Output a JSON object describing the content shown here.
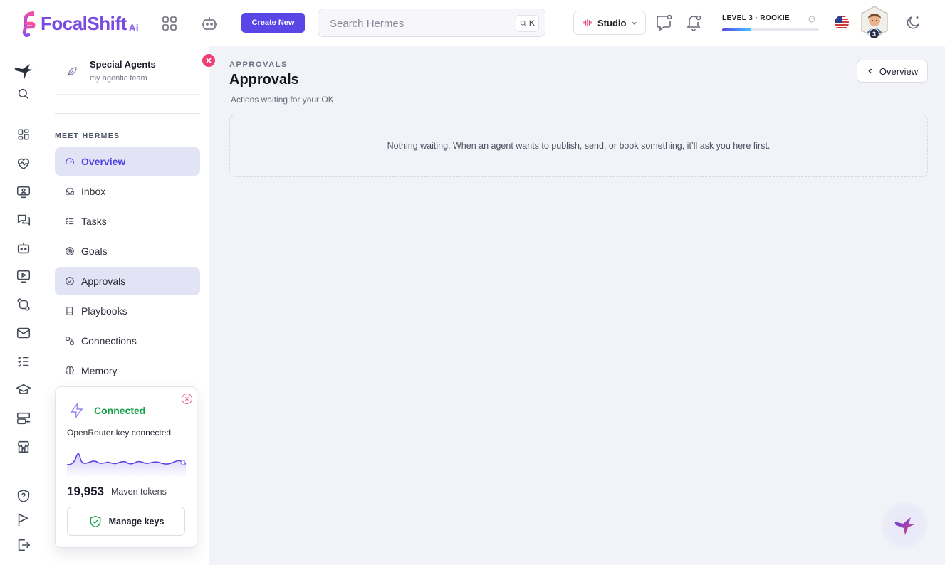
{
  "brand": {
    "name": "FocalShift",
    "suffix": "Ai"
  },
  "topbar": {
    "create_label": "Create New",
    "search_placeholder": "Search Hermes",
    "search_shortcut": "K",
    "studio_label": "Studio",
    "level_label": "LEVEL 3 · ROOKIE",
    "level_progress_pct": 30,
    "avatar_level": "3"
  },
  "team": {
    "name": "Special Agents",
    "subtitle": "my agentic team"
  },
  "sidebar": {
    "section_title": "MEET HERMES",
    "items": [
      {
        "label": "Overview",
        "icon": "gauge-icon"
      },
      {
        "label": "Inbox",
        "icon": "inbox-icon"
      },
      {
        "label": "Tasks",
        "icon": "checklist-icon"
      },
      {
        "label": "Goals",
        "icon": "target-icon"
      },
      {
        "label": "Approvals",
        "icon": "check-circle-icon"
      },
      {
        "label": "Playbooks",
        "icon": "book-icon"
      },
      {
        "label": "Connections",
        "icon": "link-icon"
      },
      {
        "label": "Memory",
        "icon": "brain-icon"
      }
    ]
  },
  "connection_card": {
    "status": "Connected",
    "description": "OpenRouter key connected",
    "tokens": "19,953",
    "tokens_unit": "Maven tokens",
    "button_label": "Manage keys"
  },
  "main": {
    "breadcrumb": "APPROVALS",
    "title": "Approvals",
    "subtitle": "Actions waiting for your OK",
    "back_button": "Overview",
    "empty_message": "Nothing waiting. When an agent wants to publish, send, or book something, it’ll ask you here first."
  },
  "colors": {
    "accent": "#5a45e6",
    "success": "#17a34a",
    "danger": "#ef3f74"
  }
}
